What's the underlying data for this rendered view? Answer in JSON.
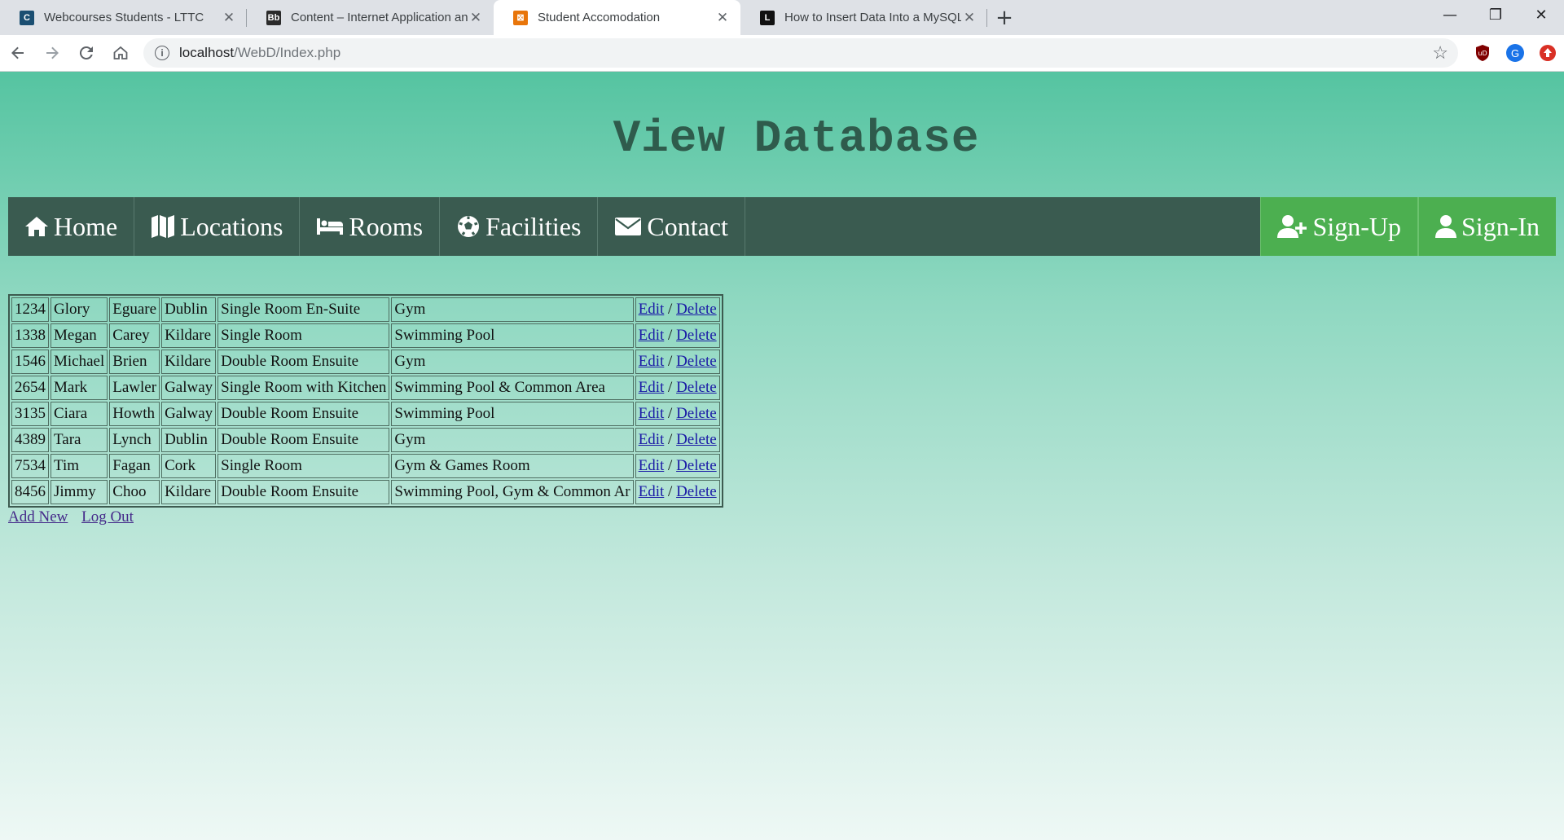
{
  "browser": {
    "tabs": [
      {
        "title": "Webcourses Students - LTTC",
        "favicon_color": "#1b4f72"
      },
      {
        "title": "Content – Internet Application an",
        "favicon_color": "#2b2b2b"
      },
      {
        "title": "Student Accomodation",
        "favicon_color": "#e8750a"
      },
      {
        "title": "How to Insert Data Into a MySQL",
        "favicon_color": "#111111"
      }
    ],
    "active_tab": 2,
    "url_host": "localhost",
    "url_path": "/WebD/Index.php",
    "profile_initial": "G"
  },
  "page": {
    "title": "View Database",
    "nav": {
      "home": "Home",
      "locations": "Locations",
      "rooms": "Rooms",
      "facilities": "Facilities",
      "contact": "Contact",
      "signup": "Sign-Up",
      "signin": "Sign-In"
    },
    "table": {
      "rows": [
        [
          "1234",
          "Glory",
          "Eguare",
          "Dublin",
          "Single Room En-Suite",
          "Gym"
        ],
        [
          "1338",
          "Megan",
          "Carey",
          "Kildare",
          "Single Room",
          "Swimming Pool"
        ],
        [
          "1546",
          "Michael",
          "Brien",
          "Kildare",
          "Double Room Ensuite",
          "Gym"
        ],
        [
          "2654",
          "Mark",
          "Lawler",
          "Galway",
          "Single Room with Kitchen",
          "Swimming Pool & Common Area"
        ],
        [
          "3135",
          "Ciara",
          "Howth",
          "Galway",
          "Double Room Ensuite",
          "Swimming Pool"
        ],
        [
          "4389",
          "Tara",
          "Lynch",
          "Dublin",
          "Double Room Ensuite",
          "Gym"
        ],
        [
          "7534",
          "Tim",
          "Fagan",
          "Cork",
          "Single Room",
          "Gym & Games Room"
        ],
        [
          "8456",
          "Jimmy",
          "Choo",
          "Kildare",
          "Double Room Ensuite",
          "Swimming Pool, Gym & Common Ar"
        ]
      ],
      "edit_label": "Edit",
      "separator": "/",
      "delete_label": "Delete"
    },
    "links": {
      "add_new": "Add New",
      "log_out": "Log Out"
    }
  }
}
